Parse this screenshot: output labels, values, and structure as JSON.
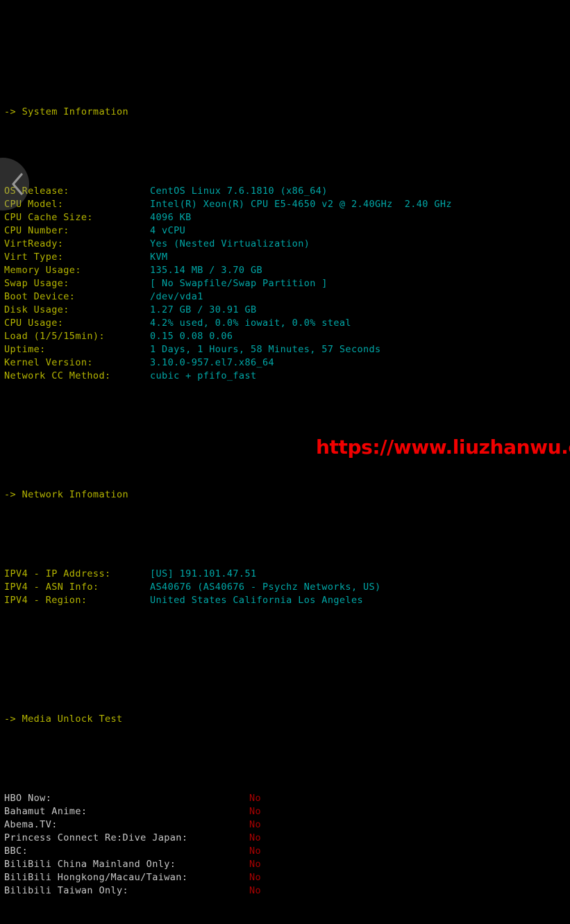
{
  "terminal": {
    "background_color": "#000000",
    "header_color": "#b5b500",
    "label_color": "#b5b500",
    "value_color": "#00a7a7",
    "media_label_color": "#c9c9c9",
    "media_value_color": "#aa0000"
  },
  "sections": {
    "system": {
      "header": "-> System Information",
      "rows": [
        {
          "label": "OS Release:",
          "value": "CentOS Linux 7.6.1810 (x86_64)"
        },
        {
          "label": "CPU Model:",
          "value": "Intel(R) Xeon(R) CPU E5-4650 v2 @ 2.40GHz  2.40 GHz"
        },
        {
          "label": "CPU Cache Size:",
          "value": "4096 KB"
        },
        {
          "label": "CPU Number:",
          "value": "4 vCPU"
        },
        {
          "label": "VirtReady:",
          "value": "Yes (Nested Virtualization)"
        },
        {
          "label": "Virt Type:",
          "value": "KVM"
        },
        {
          "label": "Memory Usage:",
          "value": "135.14 MB / 3.70 GB"
        },
        {
          "label": "Swap Usage:",
          "value": "[ No Swapfile/Swap Partition ]"
        },
        {
          "label": "Boot Device:",
          "value": "/dev/vda1"
        },
        {
          "label": "Disk Usage:",
          "value": "1.27 GB / 30.91 GB"
        },
        {
          "label": "CPU Usage:",
          "value": "4.2% used, 0.0% iowait, 0.0% steal"
        },
        {
          "label": "Load (1/5/15min):",
          "value": "0.15 0.08 0.06"
        },
        {
          "label": "Uptime:",
          "value": "1 Days, 1 Hours, 58 Minutes, 57 Seconds"
        },
        {
          "label": "Kernel Version:",
          "value": "3.10.0-957.el7.x86_64"
        },
        {
          "label": "Network CC Method:",
          "value": "cubic + pfifo_fast"
        }
      ]
    },
    "network": {
      "header": "-> Network Infomation",
      "rows": [
        {
          "label": "IPV4 - IP Address:",
          "value": "[US] 191.101.47.51"
        },
        {
          "label": "IPV4 - ASN Info:",
          "value": "AS40676 (AS40676 - Psychz Networks, US)"
        },
        {
          "label": "IPV4 - Region:",
          "value": "United States California Los Angeles"
        }
      ]
    },
    "media": {
      "header": "-> Media Unlock Test",
      "rows": [
        {
          "label": "HBO Now:",
          "value": "No"
        },
        {
          "label": "Bahamut Anime:",
          "value": "No"
        },
        {
          "label": "Abema.TV:",
          "value": "No"
        },
        {
          "label": "Princess Connect Re:Dive Japan:",
          "value": "No"
        },
        {
          "label": "BBC:",
          "value": "No"
        },
        {
          "label": "BiliBili China Mainland Only:",
          "value": "No"
        },
        {
          "label": "BiliBili Hongkong/Macau/Taiwan:",
          "value": "No"
        },
        {
          "label": "Bilibili Taiwan Only:",
          "value": "No"
        }
      ]
    }
  },
  "overlay": {
    "prev_button_icon": "chevron-left-icon"
  },
  "watermark": {
    "text": "https://www.liuzhanwu.cn",
    "color": "#f10000"
  }
}
